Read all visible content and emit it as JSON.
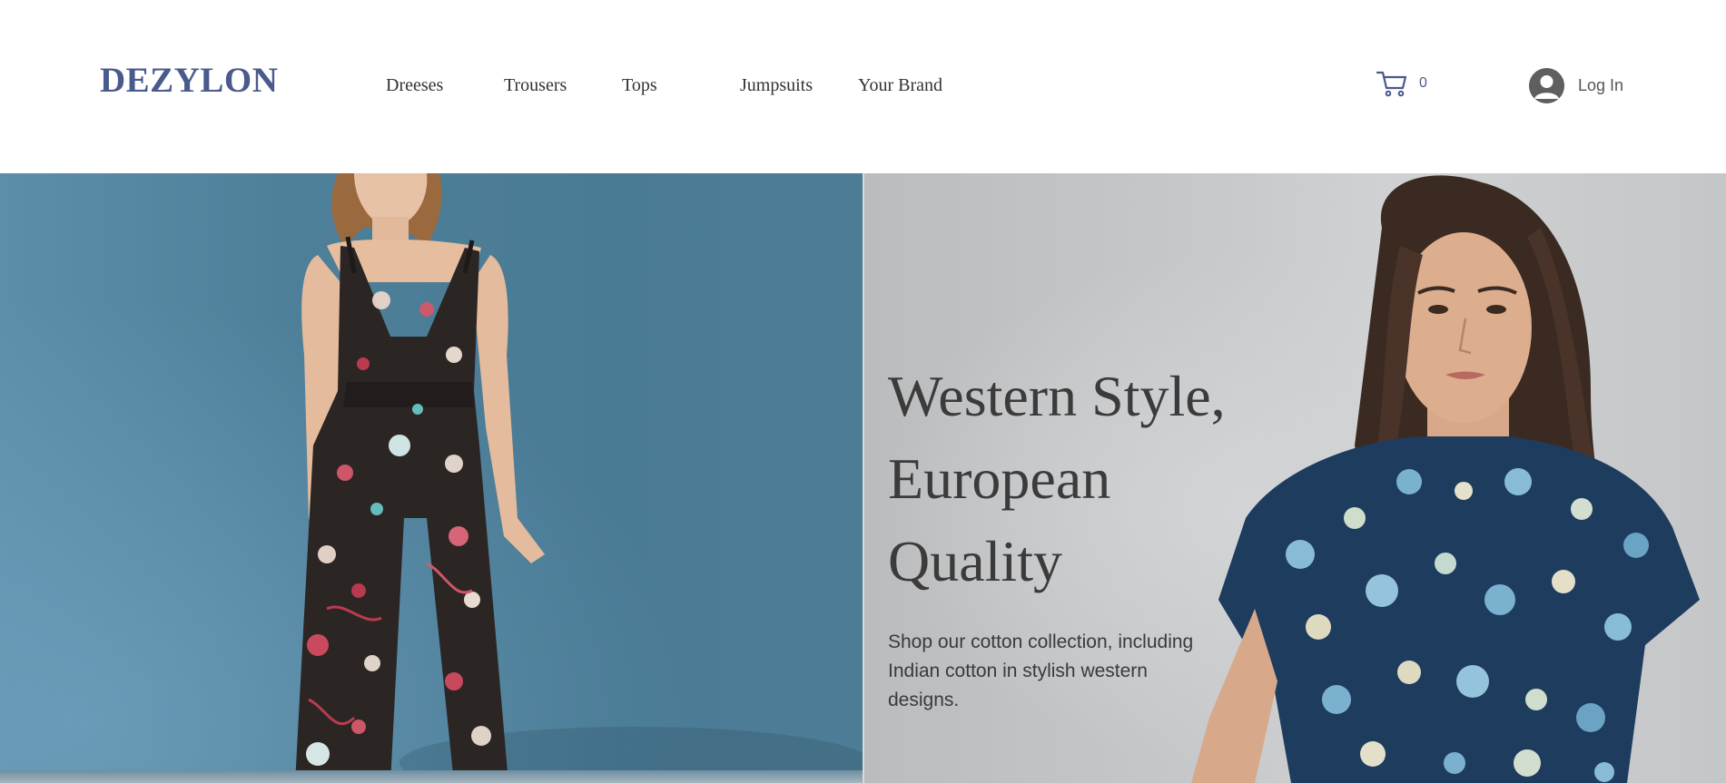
{
  "brand": {
    "logo": "DEZYLON",
    "accent_color": "#4a5a8c"
  },
  "nav": {
    "items": [
      {
        "label": "Dreeses"
      },
      {
        "label": "Trousers"
      },
      {
        "label": "Tops"
      },
      {
        "label": "Jumpsuits"
      },
      {
        "label": "Your Brand"
      }
    ]
  },
  "cart": {
    "icon": "cart-icon",
    "count": "0"
  },
  "account": {
    "icon": "user-avatar-icon",
    "login_label": "Log In"
  },
  "hero": {
    "title_lines": [
      "Western Style,",
      "European",
      "Quality"
    ],
    "subtitle": "Shop our cotton collection, including Indian cotton in stylish western designs.",
    "left_image": "model-in-floral-jumpsuit",
    "right_image": "model-in-blue-floral-top",
    "left_bg_color": "#4e7f99",
    "right_bg_color": "#c6c8ca"
  }
}
